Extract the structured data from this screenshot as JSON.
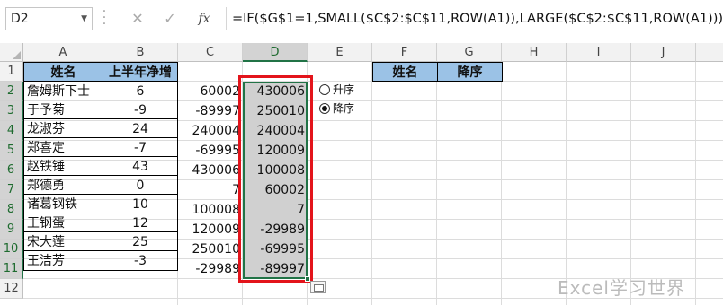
{
  "name_box": {
    "value": "D2"
  },
  "formula_bar": {
    "cancel_glyph": "✕",
    "enter_glyph": "✓",
    "fx_label": "fx",
    "formula": "=IF($G$1=1,SMALL($C$2:$C$11,ROW(A1)),LARGE($C$2:$C$11,ROW(A1)))"
  },
  "columns": [
    "A",
    "B",
    "C",
    "D",
    "E",
    "F",
    "G",
    "H",
    "I",
    "J"
  ],
  "rows": [
    "1",
    "2",
    "3",
    "4",
    "5",
    "6",
    "7",
    "8",
    "9",
    "10",
    "11",
    "12"
  ],
  "headers": {
    "name": "姓名",
    "net_increase": "上半年净增",
    "name2": "姓名",
    "order": "降序"
  },
  "table": [
    {
      "name": "詹姆斯下士",
      "b": "6",
      "c": "60002",
      "d": "430006"
    },
    {
      "name": "于予菊",
      "b": "-9",
      "c": "-89997",
      "d": "250010"
    },
    {
      "name": "龙淑芬",
      "b": "24",
      "c": "240004",
      "d": "240004"
    },
    {
      "name": "郑喜定",
      "b": "-7",
      "c": "-69995",
      "d": "120009"
    },
    {
      "name": "赵铁锤",
      "b": "43",
      "c": "430006",
      "d": "100008"
    },
    {
      "name": "郑德勇",
      "b": "0",
      "c": "7",
      "d": "60002"
    },
    {
      "name": "诸葛钢铁",
      "b": "10",
      "c": "100008",
      "d": "7"
    },
    {
      "name": "王钢蛋",
      "b": "12",
      "c": "120009",
      "d": "-29989"
    },
    {
      "name": "宋大莲",
      "b": "25",
      "c": "250010",
      "d": "-69995"
    },
    {
      "name": "王洁芳",
      "b": "-3",
      "c": "-29989",
      "d": "-89997"
    }
  ],
  "options": {
    "asc": "升序",
    "desc": "降序",
    "selected": "desc"
  },
  "watermark": "Excel学习世界",
  "colors": {
    "header_fill": "#9bc2e6",
    "highlight_border": "#e3141b",
    "selection": "#217346"
  }
}
